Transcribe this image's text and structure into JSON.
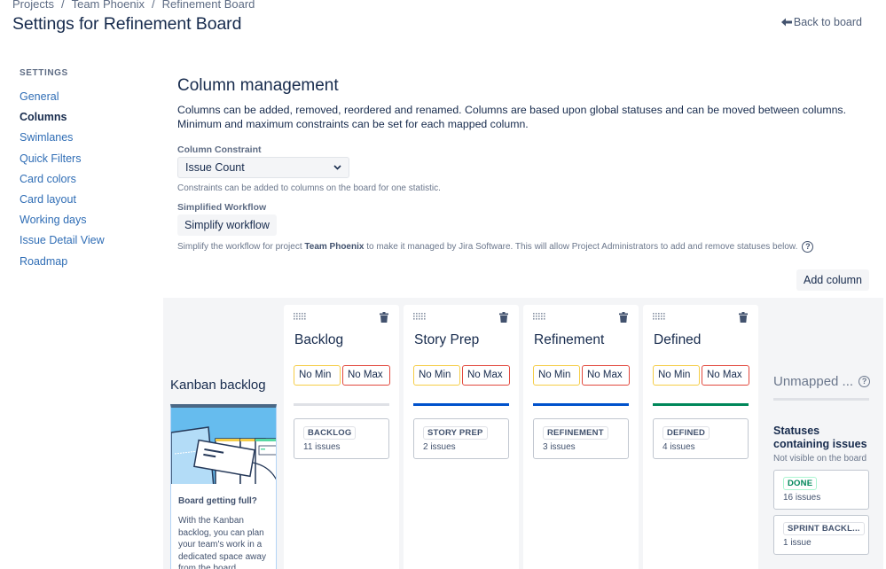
{
  "breadcrumb": [
    "Projects",
    "Team Phoenix",
    "Refinement Board"
  ],
  "page_title": "Settings for Refinement Board",
  "back_link": "Back to board",
  "sidebar": {
    "heading": "SETTINGS",
    "items": [
      {
        "label": "General",
        "active": false
      },
      {
        "label": "Columns",
        "active": true
      },
      {
        "label": "Swimlanes",
        "active": false
      },
      {
        "label": "Quick Filters",
        "active": false
      },
      {
        "label": "Card colors",
        "active": false
      },
      {
        "label": "Card layout",
        "active": false
      },
      {
        "label": "Working days",
        "active": false
      },
      {
        "label": "Issue Detail View",
        "active": false
      },
      {
        "label": "Roadmap",
        "active": false
      }
    ]
  },
  "main": {
    "title": "Column management",
    "description": "Columns can be added, removed, reordered and renamed. Columns are based upon global statuses and can be moved between columns. Minimum and maximum constraints can be set for each mapped column.",
    "constraint_label": "Column Constraint",
    "constraint_value": "Issue Count",
    "constraint_help": "Constraints can be added to columns on the board for one statistic.",
    "workflow_label": "Simplified Workflow",
    "simplify_button": "Simplify workflow",
    "workflow_help_pre": "Simplify the workflow for project ",
    "workflow_help_project": "Team Phoenix",
    "workflow_help_post": " to make it managed by Jira Software. This will allow Project Administrators to add and remove statuses below.",
    "add_column_button": "Add column"
  },
  "kanban_backlog": {
    "title": "Kanban backlog",
    "card_title": "Board getting full?",
    "card_text": "With the Kanban backlog, you can plan your team's work in a dedicated space away from the board."
  },
  "columns": [
    {
      "name": "Backlog",
      "min": "No Min",
      "max": "No Max",
      "bar_color": "#dfe1e6",
      "status": "BACKLOG",
      "count": "11 issues"
    },
    {
      "name": "Story Prep",
      "min": "No Min",
      "max": "No Max",
      "bar_color": "#0052cc",
      "status": "STORY PREP",
      "count": "2 issues"
    },
    {
      "name": "Refinement",
      "min": "No Min",
      "max": "No Max",
      "bar_color": "#0052cc",
      "status": "REFINEMENT",
      "count": "3 issues"
    },
    {
      "name": "Defined",
      "min": "No Min",
      "max": "No Max",
      "bar_color": "#00875a",
      "status": "DEFINED",
      "count": "4 issues"
    }
  ],
  "unmapped": {
    "title": "Unmapped ...",
    "subtitle": "Statuses containing issues",
    "note": "Not visible on the board",
    "statuses": [
      {
        "status": "DONE",
        "count": "16 issues",
        "color": "#00875a"
      },
      {
        "status": "SPRINT BACKL...",
        "count": "1 issue",
        "color": "#42526e"
      }
    ]
  }
}
